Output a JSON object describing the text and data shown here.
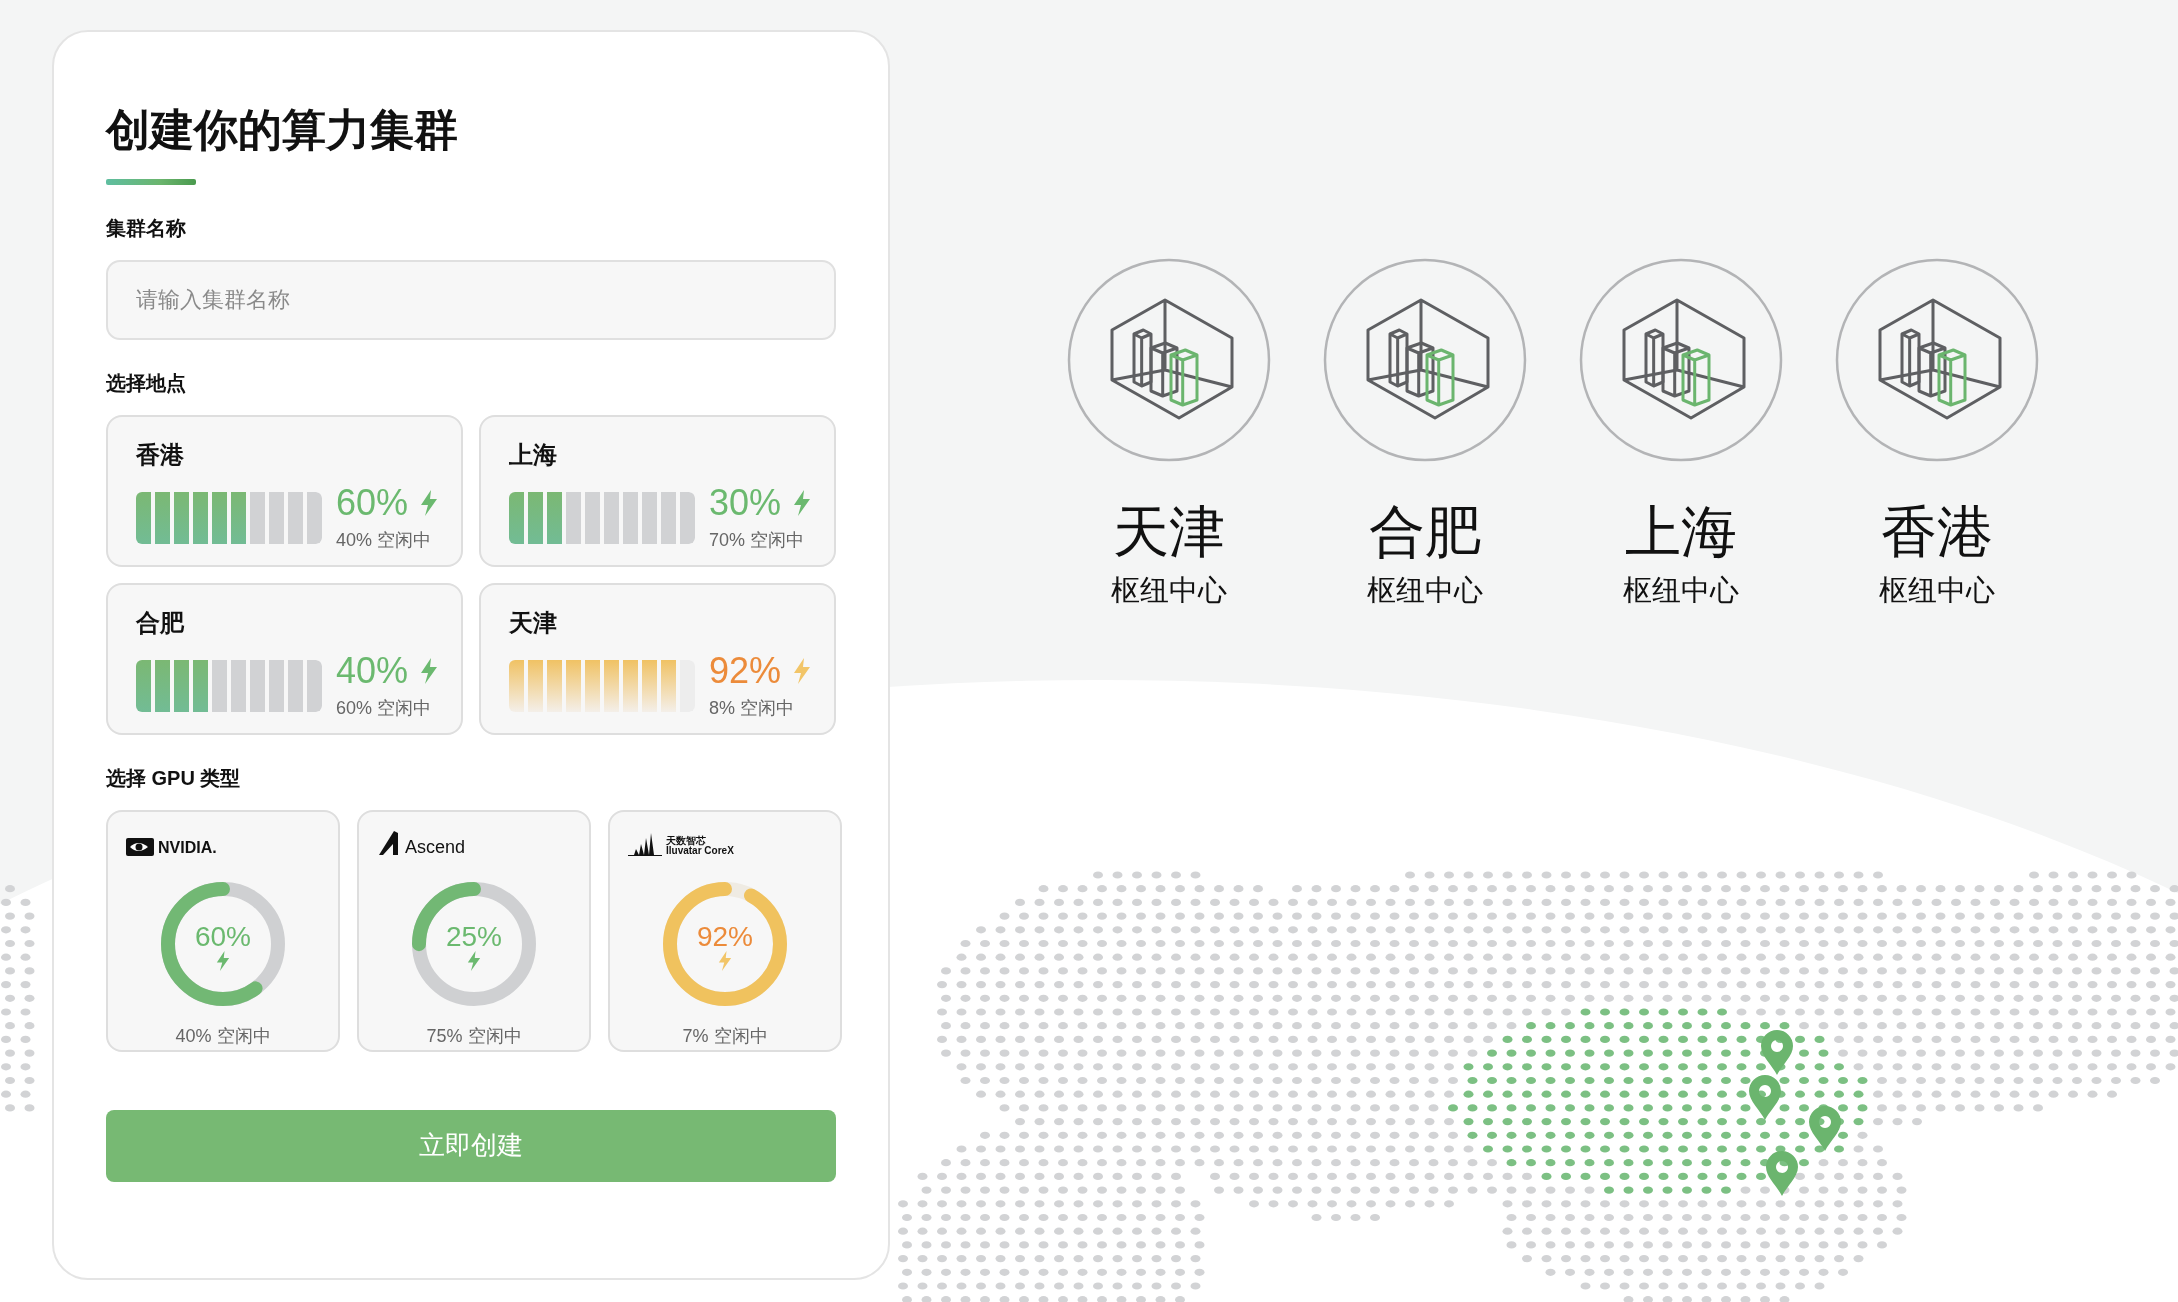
{
  "form": {
    "title": "创建你的算力集群",
    "name_label": "集群名称",
    "name_placeholder": "请输入集群名称",
    "location_label": "选择地点",
    "gpu_label": "选择 GPU 类型",
    "submit": "立即创建"
  },
  "locations": [
    {
      "name": "香港",
      "reading": "60%",
      "free": "40% 空闲中",
      "level": 0.6,
      "kind": "normal"
    },
    {
      "name": "上海",
      "reading": "30%",
      "free": "70% 空闲中",
      "level": 0.3,
      "kind": "normal"
    },
    {
      "name": "合肥",
      "reading": "40%",
      "free": "60% 空闲中",
      "level": 0.4,
      "kind": "normal"
    },
    {
      "name": "天津",
      "reading": "92%",
      "free": "8% 空闲中",
      "level": 0.92,
      "kind": "busy"
    }
  ],
  "gpus": [
    {
      "kind": "nvidia",
      "logo": [
        "NVIDIA."
      ],
      "reading": "60%",
      "free": "40% 空闲中",
      "level": 0.6
    },
    {
      "kind": "ascend",
      "logo": [
        "Ascend"
      ],
      "reading": "25%",
      "free": "75% 空闲中",
      "level": 0.25
    },
    {
      "kind": "iluvatar",
      "logo": [
        "天数智芯",
        "Iluvatar CoreX"
      ],
      "reading": "92%",
      "free": "7% 空闲中",
      "level": 0.92
    }
  ],
  "hubs": [
    {
      "city": "天津",
      "subtitle": "枢纽中心"
    },
    {
      "city": "合肥",
      "subtitle": "枢纽中心"
    },
    {
      "city": "上海",
      "subtitle": "枢纽中心"
    },
    {
      "city": "香港",
      "subtitle": "枢纽中心"
    }
  ]
}
